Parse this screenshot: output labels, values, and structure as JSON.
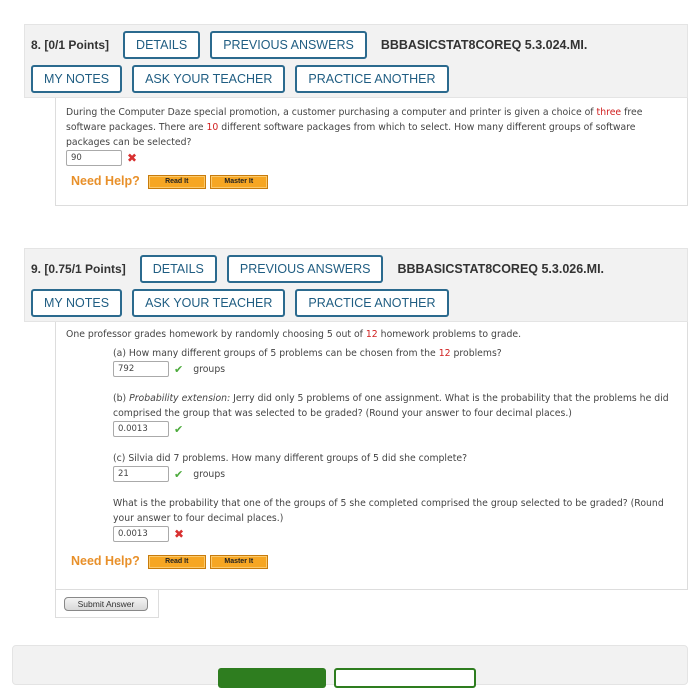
{
  "q8": {
    "number": "8.",
    "points": "[0/1 Points]",
    "details": "DETAILS",
    "previous": "PREVIOUS ANSWERS",
    "code": "BBBASICSTAT8COREQ 5.3.024.MI.",
    "my_notes": "MY NOTES",
    "ask": "ASK YOUR TEACHER",
    "practice": "PRACTICE ANOTHER",
    "text1": "During the Computer Daze special promotion, a customer purchasing a computer and printer is given a choice of ",
    "hl1": "three",
    "text2": " free software packages. There are ",
    "hl2": "10",
    "text3": " different software packages from which to select. How many different groups of software packages can be selected?",
    "answer": "90",
    "status": "incorrect",
    "need_help": "Need Help?",
    "read_it": "Read It",
    "master_it": "Master It"
  },
  "q9": {
    "number": "9.",
    "points": "[0.75/1 Points]",
    "details": "DETAILS",
    "previous": "PREVIOUS ANSWERS",
    "code": "BBBASICSTAT8COREQ 5.3.026.MI.",
    "my_notes": "MY NOTES",
    "ask": "ASK YOUR TEACHER",
    "practice": "PRACTICE ANOTHER",
    "intro1": "One professor grades homework by randomly choosing 5 out of ",
    "intro_hl": "12",
    "intro2": " homework problems to grade.",
    "a1": "(a) How many different groups of 5 problems can be chosen from the ",
    "a_hl": "12",
    "a2": " problems?",
    "a_answer": "792",
    "a_unit": "groups",
    "b_label": "(b) ",
    "b_italic": "Probability extension:",
    "b_text": " Jerry did only 5 problems of one assignment. What is the probability that the problems he did comprised the group that was selected to be graded? (Round your answer to four decimal places.)",
    "b_answer": "0.0013",
    "c_text": "(c) Silvia did 7 problems. How many different groups of 5 did she complete?",
    "c_answer": "21",
    "c_unit": "groups",
    "d_text": "What is the probability that one of the groups of 5 she completed comprised the group selected to be graded? (Round your answer to four decimal places.)",
    "d_answer": "0.0013",
    "need_help": "Need Help?",
    "read_it": "Read It",
    "master_it": "Master It",
    "submit": "Submit Answer"
  },
  "colors": {
    "accent": "#2b6a8e",
    "highlight": "#d02020",
    "correct": "#4caa3c",
    "incorrect": "#d83030",
    "help": "#e8902a"
  }
}
